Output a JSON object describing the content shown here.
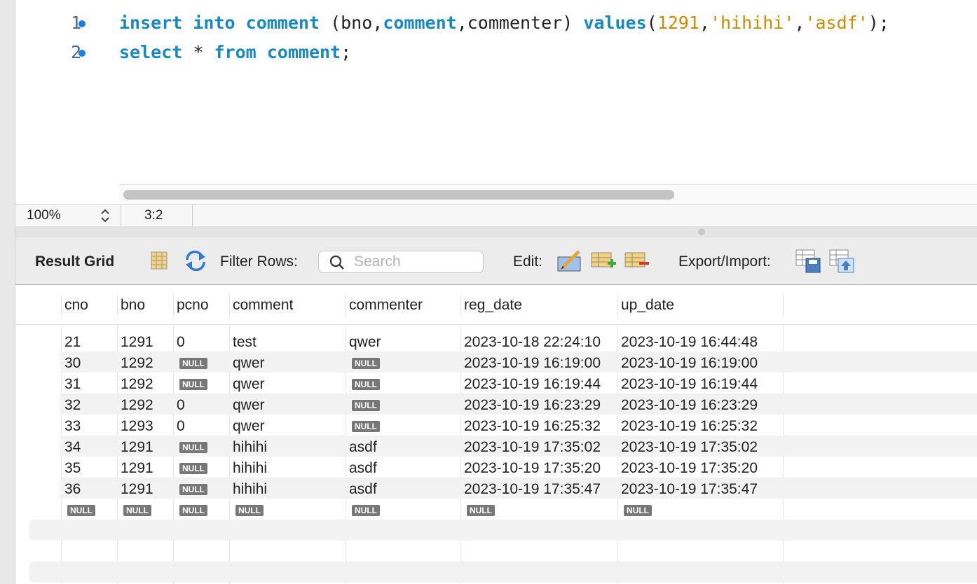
{
  "editor": {
    "lines": [
      {
        "number": "1",
        "tokens": [
          {
            "t": "insert",
            "c": "kw"
          },
          {
            "t": " ",
            "c": ""
          },
          {
            "t": "into",
            "c": "kw"
          },
          {
            "t": " ",
            "c": ""
          },
          {
            "t": "comment",
            "c": "kw"
          },
          {
            "t": " (bno,",
            "c": ""
          },
          {
            "t": "comment",
            "c": "kw"
          },
          {
            "t": ",commenter) ",
            "c": ""
          },
          {
            "t": "values",
            "c": "kw"
          },
          {
            "t": "(",
            "c": ""
          },
          {
            "t": "1291",
            "c": "num"
          },
          {
            "t": ",",
            "c": ""
          },
          {
            "t": "'hihihi'",
            "c": "str"
          },
          {
            "t": ",",
            "c": ""
          },
          {
            "t": "'asdf'",
            "c": "str"
          },
          {
            "t": ");",
            "c": ""
          }
        ]
      },
      {
        "number": "2",
        "tokens": [
          {
            "t": "select",
            "c": "kw"
          },
          {
            "t": " * ",
            "c": ""
          },
          {
            "t": "from",
            "c": "kw"
          },
          {
            "t": " ",
            "c": ""
          },
          {
            "t": "comment",
            "c": "kw"
          },
          {
            "t": ";",
            "c": ""
          }
        ]
      }
    ]
  },
  "status": {
    "zoom": "100%",
    "cursor": "3:2"
  },
  "toolbar": {
    "title": "Result Grid",
    "filter_label": "Filter Rows:",
    "search_placeholder": "Search",
    "edit_label": "Edit:",
    "export_label": "Export/Import:"
  },
  "grid": {
    "columns": [
      "cno",
      "bno",
      "pcno",
      "comment",
      "commenter",
      "reg_date",
      "up_date"
    ],
    "null_text": "NULL",
    "rows": [
      [
        "21",
        "1291",
        "0",
        "test",
        "qwer",
        "2023-10-18 22:24:10",
        "2023-10-19 16:44:48"
      ],
      [
        "30",
        "1292",
        null,
        "qwer",
        null,
        "2023-10-19 16:19:00",
        "2023-10-19 16:19:00"
      ],
      [
        "31",
        "1292",
        null,
        "qwer",
        null,
        "2023-10-19 16:19:44",
        "2023-10-19 16:19:44"
      ],
      [
        "32",
        "1292",
        "0",
        "qwer",
        null,
        "2023-10-19 16:23:29",
        "2023-10-19 16:23:29"
      ],
      [
        "33",
        "1293",
        "0",
        "qwer",
        null,
        "2023-10-19 16:25:32",
        "2023-10-19 16:25:32"
      ],
      [
        "34",
        "1291",
        null,
        "hihihi",
        "asdf",
        "2023-10-19 17:35:02",
        "2023-10-19 17:35:02"
      ],
      [
        "35",
        "1291",
        null,
        "hihihi",
        "asdf",
        "2023-10-19 17:35:20",
        "2023-10-19 17:35:20"
      ],
      [
        "36",
        "1291",
        null,
        "hihihi",
        "asdf",
        "2023-10-19 17:35:47",
        "2023-10-19 17:35:47"
      ],
      [
        null,
        null,
        null,
        null,
        null,
        null,
        null
      ]
    ]
  },
  "colors": {
    "keyword": "#1788c2",
    "literal": "#cf8a00",
    "line_marker": "#1a7fe0",
    "null_badge": "#777777"
  }
}
